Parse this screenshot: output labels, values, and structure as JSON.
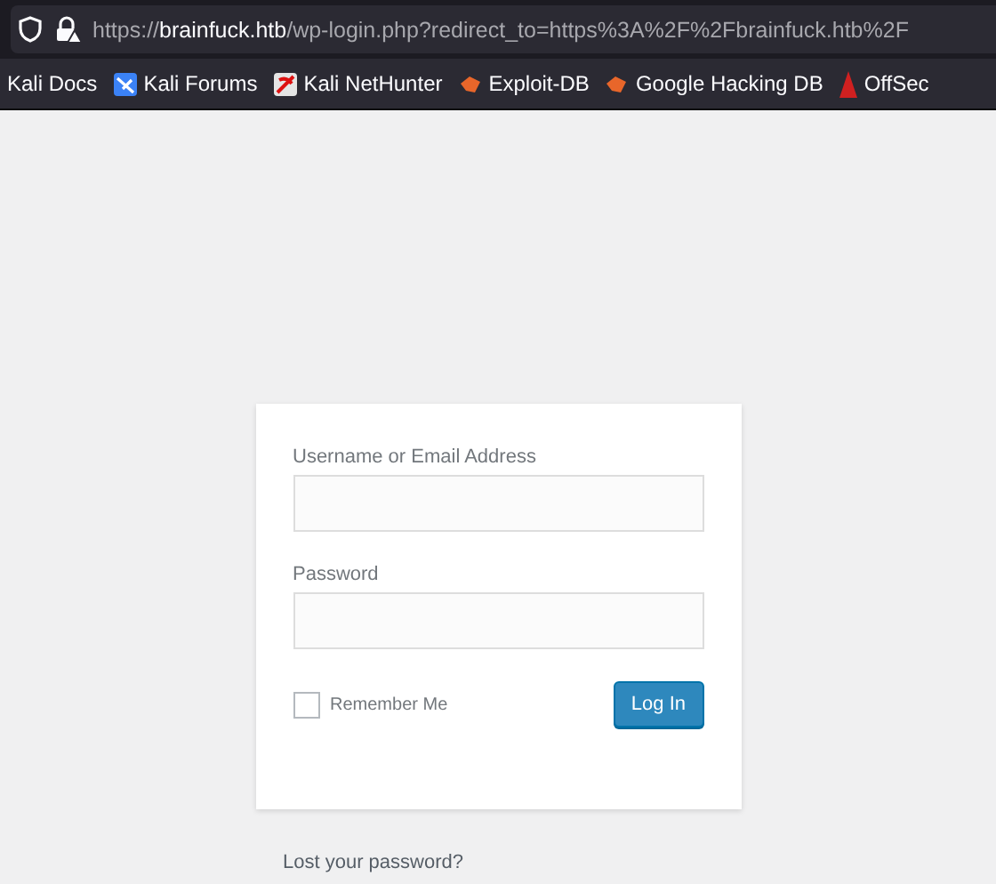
{
  "address_bar": {
    "url": "https://**brainfuck.htb**/wp-login.php?redirect_to=https%3A%2F%2Fbrainfuck.htb%2F"
  },
  "bookmarks": [
    {
      "label": "Kali Docs",
      "kind": "none"
    },
    {
      "label": "Kali Forums",
      "kind": "forums"
    },
    {
      "label": "Kali NetHunter",
      "kind": "nethunter"
    },
    {
      "label": "Exploit-DB",
      "kind": "exploit"
    },
    {
      "label": "Google Hacking DB",
      "kind": "exploit"
    },
    {
      "label": "OffSec",
      "kind": "offsec"
    }
  ],
  "login": {
    "username_label": "Username or Email Address",
    "password_label": "Password",
    "remember_label": "Remember Me",
    "remember_checked": false,
    "submit": "Log In"
  },
  "lost_password": "Lost your password?"
}
